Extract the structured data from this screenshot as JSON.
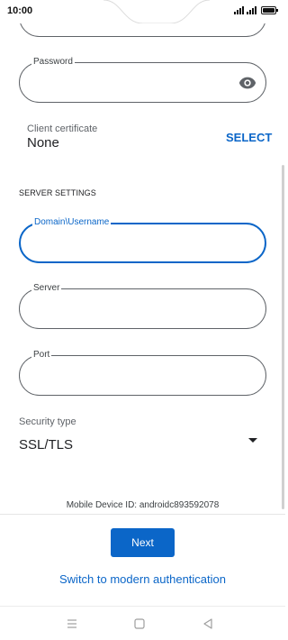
{
  "status_bar": {
    "time": "10:00"
  },
  "form": {
    "password": {
      "label": "Password",
      "value": "",
      "toggle_icon": "eye-icon"
    },
    "client_certificate": {
      "label": "Client certificate",
      "value": "None",
      "action": "SELECT"
    },
    "server_settings": {
      "heading": "SERVER SETTINGS",
      "domain_username": {
        "label": "Domain\\Username",
        "value": ""
      },
      "server": {
        "label": "Server",
        "value": ""
      },
      "port": {
        "label": "Port",
        "value": ""
      }
    },
    "security_type": {
      "label": "Security type",
      "selected": "SSL/TLS"
    }
  },
  "device_id": "Mobile Device ID: androidc893592078",
  "actions": {
    "next": "Next",
    "modern_auth": "Switch to modern authentication"
  },
  "nav_bar": {
    "buttons": [
      "menu-icon",
      "home-icon",
      "back-icon"
    ]
  },
  "colors": {
    "accent": "#0b66c8",
    "outline": "#5f6368",
    "text": "#202124"
  }
}
